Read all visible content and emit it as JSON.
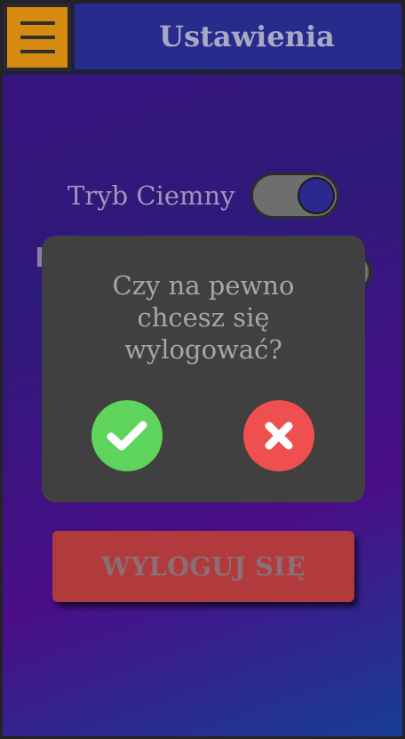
{
  "header": {
    "title": "Ustawienia",
    "menu_icon": "hamburger-menu-icon",
    "menu_color": "#d68a10",
    "title_bar_color": "#262b8c"
  },
  "settings": [
    {
      "label": "Tryb Ciemny",
      "enabled": true
    }
  ],
  "logout_button": {
    "label": "WYLOGUJ SIĘ",
    "color": "#b13a3d"
  },
  "dialog": {
    "question_lines": [
      "Czy na pewno",
      "chcesz się",
      "wylogować?"
    ],
    "confirm_icon": "checkmark-icon",
    "confirm_color": "#5ed45c",
    "cancel_icon": "x-mark-icon",
    "cancel_color": "#f04f4f"
  }
}
